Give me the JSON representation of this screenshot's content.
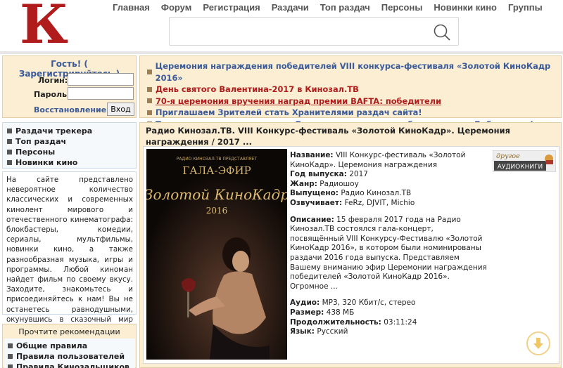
{
  "logo": {
    "letter": "К"
  },
  "nav": {
    "items": [
      "Главная",
      "Форум",
      "Регистрация",
      "Раздачи",
      "Топ раздач",
      "Персоны",
      "Новинки кино",
      "Группы"
    ]
  },
  "search": {
    "placeholder": ""
  },
  "login": {
    "title": "Гость! ( Зарегистрируйтесь )",
    "login_label": "Логин:",
    "password_label": "Пароль:",
    "restore_label": "Восстановление!",
    "submit_label": "Вход"
  },
  "menu": {
    "items": [
      "Раздачи трекера",
      "Топ раздач",
      "Персоны",
      "Новинки кино"
    ]
  },
  "about": {
    "text": "На сайте представлено невероятное количество классических и современных кинолент мирового и отечественного кинематографа: блокбастеры, комедии, сериалы, мультфильмы, новинки кино, а также разнообразная музыка, игры и программы. Любой киноман найдет фильм по своему вкусу. Заходите, знакомьтесь и присоединяйтесь к нам! Вы не останетесь равнодушными, окунувшись в сказочный мир кино и доброжелательную атмосферу."
  },
  "recs": {
    "title": "Прочтите рекомендации",
    "items": [
      "Общие правила",
      "Правила пользователей",
      "Правила Кинозальщиков"
    ]
  },
  "news": {
    "items": [
      "Церемония награждения победителей VIII конкурса-фестиваля «Золотой КиноКадр 2016»",
      "День святого Валентина-2017 в Кинозал.ТВ",
      "70-я церемония вручения наград премии BAFTA: победители",
      "Приглашаем Зрителей стать Хранителями раздач сайта!",
      "Топ книжных раздач месяца. Будь в курсе новинок и бестселлеров Библиотеки!"
    ]
  },
  "release": {
    "title": "Радио Кинозал.ТВ. VIII Конкурс-фестиваль «Золотой КиноКадр». Церемония награждения / 2017 ...",
    "poster": {
      "small": "РАДИО КИНОЗАЛ.ТВ ПРЕДСТАВЛЯЕТ",
      "gala": "ГАЛА-ЭФИР",
      "name": "«Золотой КиноКадр»",
      "year": "2016"
    },
    "fields": {
      "name_label": "Название:",
      "name_value": "VIII Конкурс-фестиваль «Золотой КиноКадр». Церемония награждения",
      "year_label": "Год выпуска:",
      "year_value": "2017",
      "genre_label": "Жанр:",
      "genre_value": "Радиошоу",
      "released_label": "Выпущено:",
      "released_value": "Радио Кинозал.ТВ",
      "voiced_label": "Озвучивает:",
      "voiced_value": "FeRz, DJVIT, Michio",
      "desc_label": "Описание:",
      "desc_value": "15 февраля 2017 года на Радио Кинозал.ТВ состоялся гала-концерт, посвящённый VIII Конкурсу-Фестивалю «Золотой КиноКадр 2016», в котором были номинированы раздачи 2016 года выпуска. Представляем Вашему вниманию эфир Церемонии награждения победителей «Золотой КиноКадр 2016». Огромное ...",
      "audio_label": "Аудио:",
      "audio_value": "MP3, 320 Кбит/с, стерео",
      "size_label": "Размер:",
      "size_value": "438 МБ",
      "duration_label": "Продолжительность:",
      "duration_value": "03:11:24",
      "lang_label": "Язык:",
      "lang_value": "Русский"
    },
    "badge": {
      "top": "другое",
      "bottom": "АУДИОКНИГИ"
    }
  },
  "colors": {
    "accent_red": "#b01c1c",
    "link_blue": "#3a5a99",
    "panel_beige": "#fbeed2"
  }
}
